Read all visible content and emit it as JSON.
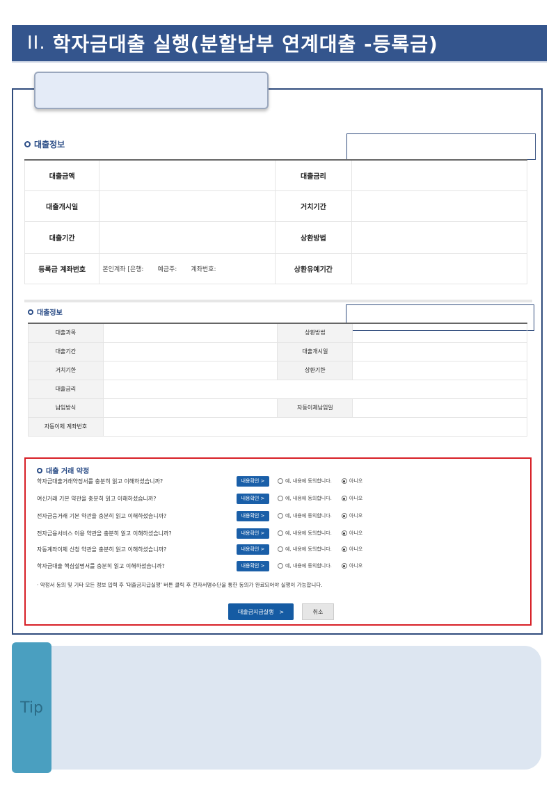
{
  "header": {
    "num": "II.",
    "title": "학자금대출 실행(분할납부 연계대출 -등록금)"
  },
  "loan_info": {
    "heading": "대출정보",
    "rows": [
      {
        "l1": "대출금액",
        "l2": "대출금리"
      },
      {
        "l1": "대출개시일",
        "l2": "거치기간"
      },
      {
        "l1": "대출기간",
        "l2": "상환방법"
      },
      {
        "l1": "등록금 계좌번호",
        "l2": "상환유예기간"
      }
    ],
    "account_parts": [
      "본인계좌 [은행:",
      "예금주:",
      "계좌번호:"
    ]
  },
  "loan_info2": {
    "heading": "대출정보",
    "rows": [
      {
        "l1": "대출과목",
        "l2": "상환방법"
      },
      {
        "l1": "대출기간",
        "l2": "대출개시일"
      },
      {
        "l1": "거치기한",
        "l2": "상환기한"
      },
      {
        "l1": "대출금리",
        "l2": ""
      },
      {
        "l1": "납입방식",
        "l2": "자동이체납입일"
      },
      {
        "l1": "자동이체 계좌번호",
        "l2": ""
      }
    ]
  },
  "agreement": {
    "heading": "대출 거래 약정",
    "view_label": "내용확인",
    "yes_label": "예, 내용에 동의합니다.",
    "no_label": "아니오",
    "questions": [
      "학자금대출거래약정서를 충분히 읽고 이해하셨습니까?",
      "여신거래 기본 약관을 충분히 읽고 이해하셨습니까?",
      "전자금융거래 기본 약관을 충분히 읽고 이해하셨습니까?",
      "전자금융서비스 이용 약관을 충분히 읽고 이해하셨습니까?",
      "자동계좌이체 신청 약관을 충분히 읽고 이해하셨습니까?",
      "학자금대출 핵심설명서를 충분히 읽고 이해하셨습니까?"
    ],
    "note": "· 약정서 동의 및 기타 모든 정보 입력 후 '대출금지급실행' 버튼 클릭 후 전자서명수단을 통한 동의가 완료되어야 실행이 가능합니다.",
    "execute_label": "대출금지급실행",
    "cancel_label": "취소"
  },
  "tip": {
    "label": "Tip"
  }
}
